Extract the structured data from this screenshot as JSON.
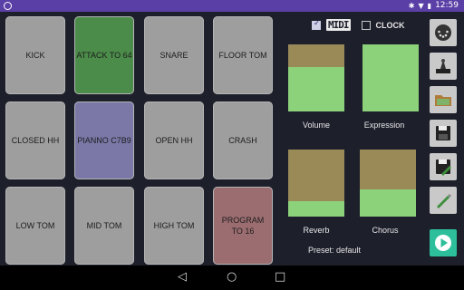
{
  "status_bar": {
    "time": "12:59",
    "icons": [
      "app-badge-icon",
      "bluetooth-icon",
      "wifi-icon",
      "battery-icon"
    ]
  },
  "pads": [
    {
      "label": "KICK",
      "color": "#9e9e9e"
    },
    {
      "label": "ATTACK TO 64",
      "color": "#4c8c4a"
    },
    {
      "label": "SNARE",
      "color": "#9e9e9e"
    },
    {
      "label": "FLOOR TOM",
      "color": "#9e9e9e"
    },
    {
      "label": "CLOSED HH",
      "color": "#9e9e9e"
    },
    {
      "label": "PIANNO C7B9",
      "color": "#7b78a8"
    },
    {
      "label": "OPEN HH",
      "color": "#9e9e9e"
    },
    {
      "label": "CRASH",
      "color": "#9e9e9e"
    },
    {
      "label": "LOW TOM",
      "color": "#9e9e9e"
    },
    {
      "label": "MID TOM",
      "color": "#9e9e9e"
    },
    {
      "label": "HIGH TOM",
      "color": "#9e9e9e"
    },
    {
      "label": "PROGRAM TO 16",
      "color": "#9b6d70"
    }
  ],
  "midi": {
    "midi_checked": true,
    "midi_label": "MIDI",
    "clock_checked": false,
    "clock_label": "CLOCK"
  },
  "faders": [
    {
      "label": "Volume",
      "level": 0.66
    },
    {
      "label": "Expression",
      "level": 1.0
    },
    {
      "label": "Reverb",
      "level": 0.23
    },
    {
      "label": "Chorus",
      "level": 0.4
    }
  ],
  "preset": {
    "label": "Preset: default"
  },
  "toolbar": [
    "midi-connector-icon",
    "keyboard-piano-icon",
    "folder-open-icon",
    "save-icon",
    "save-as-icon",
    "edit-pencil-icon",
    "play-icon"
  ],
  "colors": {
    "accent": "#5a3fa6",
    "pad_default": "#9e9e9e",
    "fader_fill": "#8cd27b",
    "fader_bg": "#9a8a58",
    "play": "#2dbf9c"
  }
}
